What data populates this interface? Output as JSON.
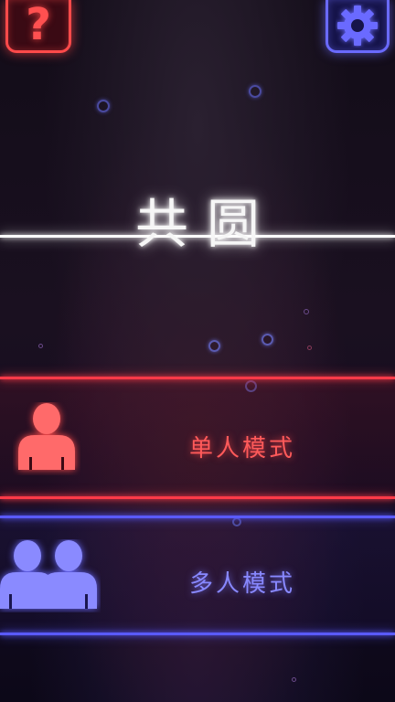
{
  "title": "共圆",
  "help_icon": "question-mark-icon",
  "help_glyph": "?",
  "settings_icon": "gear-icon",
  "modes": [
    {
      "label": "单人模式",
      "icon": "single-person-icon",
      "color": "#ff4a4a"
    },
    {
      "label": "多人模式",
      "icon": "two-people-icon",
      "color": "#6a6aff"
    }
  ],
  "colors": {
    "background": "#120c18",
    "title": "#ffffff",
    "accent_red": "#ff3a48",
    "accent_blue": "#5a5aff"
  }
}
